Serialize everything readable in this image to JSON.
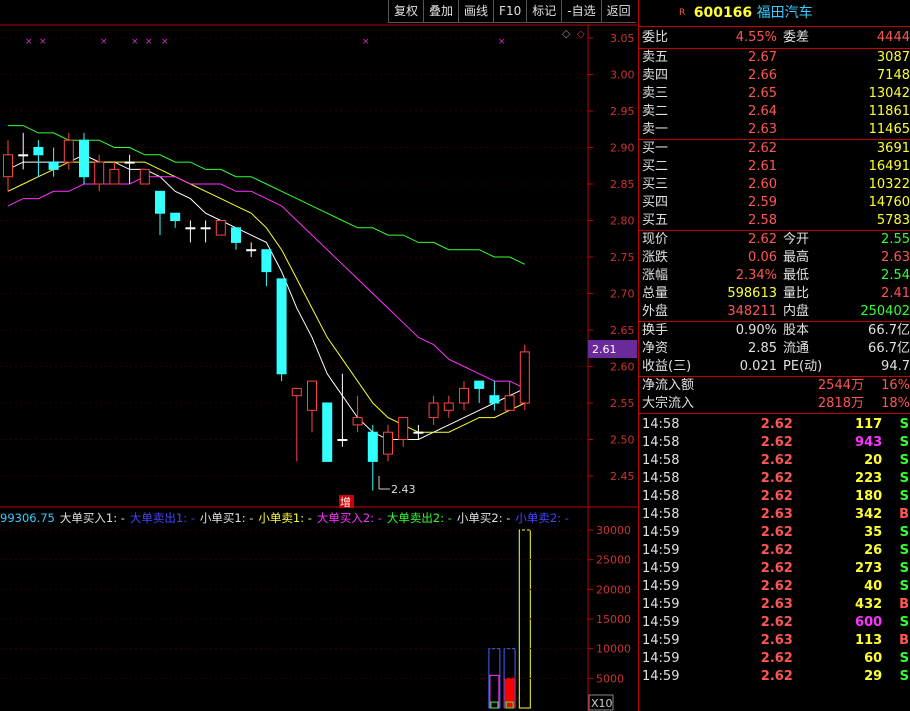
{
  "toolbar": {
    "items": [
      "复权",
      "叠加",
      "画线",
      "F10",
      "标记",
      "-自选",
      "返回"
    ]
  },
  "stock": {
    "flag": "R",
    "code": "600166",
    "name": "福田汽车"
  },
  "price_axis": {
    "ticks": [
      "3.05",
      "3.00",
      "2.95",
      "2.90",
      "2.85",
      "2.80",
      "2.75",
      "2.70",
      "2.65",
      "2.60",
      "2.55",
      "2.50",
      "2.45"
    ],
    "current": "2.61"
  },
  "chart_labels": {
    "low_marker": "2.43",
    "add_marker": "增"
  },
  "volume_axis": {
    "ticks": [
      "30000",
      "25000",
      "20000",
      "15000",
      "10000",
      "5000"
    ],
    "multiplier": "X10"
  },
  "legend": [
    {
      "text": "99306.75",
      "color": "#33ccff"
    },
    {
      "text": "大单买入1: -",
      "color": "#e0e0e0"
    },
    {
      "text": "大单卖出1: -",
      "color": "#4444ff"
    },
    {
      "text": "小单买1: -",
      "color": "#e0e0e0"
    },
    {
      "text": "小单卖1: -",
      "color": "#ffff33"
    },
    {
      "text": "大单买入2: -",
      "color": "#ff33ff"
    },
    {
      "text": "大单卖出2: -",
      "color": "#33ff33"
    },
    {
      "text": "小单买2: -",
      "color": "#e0e0e0"
    },
    {
      "text": "小单卖2: -",
      "color": "#4444ff"
    }
  ],
  "quote": {
    "wei": {
      "label": "委比",
      "value": "4.55%",
      "label2": "委差",
      "value2": "4444"
    },
    "sells": [
      {
        "label": "卖五",
        "price": "2.67",
        "vol": "3087"
      },
      {
        "label": "卖四",
        "price": "2.66",
        "vol": "7148"
      },
      {
        "label": "卖三",
        "price": "2.65",
        "vol": "13042"
      },
      {
        "label": "卖二",
        "price": "2.64",
        "vol": "11861"
      },
      {
        "label": "卖一",
        "price": "2.63",
        "vol": "11465"
      }
    ],
    "buys": [
      {
        "label": "买一",
        "price": "2.62",
        "vol": "3691"
      },
      {
        "label": "买二",
        "price": "2.61",
        "vol": "16491"
      },
      {
        "label": "买三",
        "price": "2.60",
        "vol": "10322"
      },
      {
        "label": "买四",
        "price": "2.59",
        "vol": "14760"
      },
      {
        "label": "买五",
        "price": "2.58",
        "vol": "5783"
      }
    ],
    "stats1": [
      {
        "l1": "现价",
        "v1": "2.62",
        "c1": "#ff5555",
        "l2": "今开",
        "v2": "2.55",
        "c2": "#33ff33"
      },
      {
        "l1": "涨跌",
        "v1": "0.06",
        "c1": "#ff5555",
        "l2": "最高",
        "v2": "2.63",
        "c2": "#ff5555"
      },
      {
        "l1": "涨幅",
        "v1": "2.34%",
        "c1": "#ff5555",
        "l2": "最低",
        "v2": "2.54",
        "c2": "#33ff33"
      },
      {
        "l1": "总量",
        "v1": "598613",
        "c1": "#ffff33",
        "l2": "量比",
        "v2": "2.41",
        "c2": "#ff5555"
      },
      {
        "l1": "外盘",
        "v1": "348211",
        "c1": "#ff5555",
        "l2": "内盘",
        "v2": "250402",
        "c2": "#33ff33"
      }
    ],
    "stats2": [
      {
        "l1": "换手",
        "v1": "0.90%",
        "l2": "股本",
        "v2": "66.7亿"
      },
      {
        "l1": "净资",
        "v1": "2.85",
        "l2": "流通",
        "v2": "66.7亿"
      },
      {
        "l1": "收益(三)",
        "v1": "0.021",
        "l2": "PE(动)",
        "v2": "94.7"
      }
    ],
    "flows": [
      {
        "label": "净流入额",
        "value": "2544万",
        "pct": "16%"
      },
      {
        "label": "大宗流入",
        "value": "2818万",
        "pct": "18%"
      }
    ]
  },
  "ticks": [
    {
      "time": "14:58",
      "price": "2.62",
      "vol": "117",
      "bs": "S",
      "vc": "#ffff33"
    },
    {
      "time": "14:58",
      "price": "2.62",
      "vol": "943",
      "bs": "S",
      "vc": "#ff33ff"
    },
    {
      "time": "14:58",
      "price": "2.62",
      "vol": "20",
      "bs": "S",
      "vc": "#ffff33"
    },
    {
      "time": "14:58",
      "price": "2.62",
      "vol": "223",
      "bs": "S",
      "vc": "#ffff33"
    },
    {
      "time": "14:58",
      "price": "2.62",
      "vol": "180",
      "bs": "S",
      "vc": "#ffff33"
    },
    {
      "time": "14:58",
      "price": "2.63",
      "vol": "342",
      "bs": "B",
      "vc": "#ffff33"
    },
    {
      "time": "14:59",
      "price": "2.62",
      "vol": "35",
      "bs": "S",
      "vc": "#ffff33"
    },
    {
      "time": "14:59",
      "price": "2.62",
      "vol": "26",
      "bs": "S",
      "vc": "#ffff33"
    },
    {
      "time": "14:59",
      "price": "2.62",
      "vol": "273",
      "bs": "S",
      "vc": "#ffff33"
    },
    {
      "time": "14:59",
      "price": "2.62",
      "vol": "40",
      "bs": "S",
      "vc": "#ffff33"
    },
    {
      "time": "14:59",
      "price": "2.63",
      "vol": "432",
      "bs": "B",
      "vc": "#ffff33"
    },
    {
      "time": "14:59",
      "price": "2.62",
      "vol": "600",
      "bs": "S",
      "vc": "#ff33ff"
    },
    {
      "time": "14:59",
      "price": "2.63",
      "vol": "113",
      "bs": "B",
      "vc": "#ffff33"
    },
    {
      "time": "14:59",
      "price": "2.62",
      "vol": "60",
      "bs": "S",
      "vc": "#ffff33"
    },
    {
      "time": "14:59",
      "price": "2.62",
      "vol": "29",
      "bs": "S",
      "vc": "#ffff33"
    }
  ],
  "chart_data": {
    "type": "candlestick",
    "ylim": [
      2.41,
      3.07
    ],
    "candles": [
      {
        "o": 2.86,
        "c": 2.89,
        "h": 2.91,
        "l": 2.84
      },
      {
        "o": 2.89,
        "c": 2.89,
        "h": 2.92,
        "l": 2.87
      },
      {
        "o": 2.9,
        "c": 2.89,
        "h": 2.91,
        "l": 2.86
      },
      {
        "o": 2.88,
        "c": 2.87,
        "h": 2.9,
        "l": 2.86
      },
      {
        "o": 2.88,
        "c": 2.91,
        "h": 2.92,
        "l": 2.87
      },
      {
        "o": 2.91,
        "c": 2.86,
        "h": 2.92,
        "l": 2.85
      },
      {
        "o": 2.85,
        "c": 2.88,
        "h": 2.89,
        "l": 2.84
      },
      {
        "o": 2.85,
        "c": 2.87,
        "h": 2.88,
        "l": 2.85
      },
      {
        "o": 2.88,
        "c": 2.88,
        "h": 2.89,
        "l": 2.85
      },
      {
        "o": 2.85,
        "c": 2.87,
        "h": 2.87,
        "l": 2.85
      },
      {
        "o": 2.84,
        "c": 2.81,
        "h": 2.84,
        "l": 2.78
      },
      {
        "o": 2.81,
        "c": 2.8,
        "h": 2.81,
        "l": 2.79
      },
      {
        "o": 2.79,
        "c": 2.79,
        "h": 2.8,
        "l": 2.77
      },
      {
        "o": 2.79,
        "c": 2.79,
        "h": 2.8,
        "l": 2.77
      },
      {
        "o": 2.78,
        "c": 2.8,
        "h": 2.8,
        "l": 2.78
      },
      {
        "o": 2.79,
        "c": 2.77,
        "h": 2.79,
        "l": 2.76
      },
      {
        "o": 2.76,
        "c": 2.76,
        "h": 2.77,
        "l": 2.75
      },
      {
        "o": 2.76,
        "c": 2.73,
        "h": 2.76,
        "l": 2.71
      },
      {
        "o": 2.72,
        "c": 2.59,
        "h": 2.72,
        "l": 2.58
      },
      {
        "o": 2.56,
        "c": 2.57,
        "h": 2.57,
        "l": 2.47
      },
      {
        "o": 2.54,
        "c": 2.58,
        "h": 2.58,
        "l": 2.51
      },
      {
        "o": 2.55,
        "c": 2.47,
        "h": 2.55,
        "l": 2.47
      },
      {
        "o": 2.5,
        "c": 2.5,
        "h": 2.59,
        "l": 2.49
      },
      {
        "o": 2.52,
        "c": 2.53,
        "h": 2.56,
        "l": 2.51
      },
      {
        "o": 2.51,
        "c": 2.47,
        "h": 2.52,
        "l": 2.43
      },
      {
        "o": 2.48,
        "c": 2.51,
        "h": 2.52,
        "l": 2.47
      },
      {
        "o": 2.5,
        "c": 2.53,
        "h": 2.53,
        "l": 2.49
      },
      {
        "o": 2.51,
        "c": 2.51,
        "h": 2.52,
        "l": 2.5
      },
      {
        "o": 2.53,
        "c": 2.55,
        "h": 2.56,
        "l": 2.52
      },
      {
        "o": 2.54,
        "c": 2.55,
        "h": 2.56,
        "l": 2.53
      },
      {
        "o": 2.55,
        "c": 2.57,
        "h": 2.58,
        "l": 2.54
      },
      {
        "o": 2.58,
        "c": 2.57,
        "h": 2.58,
        "l": 2.55
      },
      {
        "o": 2.56,
        "c": 2.55,
        "h": 2.58,
        "l": 2.54
      },
      {
        "o": 2.54,
        "c": 2.56,
        "h": 2.58,
        "l": 2.54
      },
      {
        "o": 2.55,
        "c": 2.62,
        "h": 2.63,
        "l": 2.54
      }
    ],
    "ma_series": [
      {
        "color": "#ffffff",
        "values": [
          2.87,
          2.88,
          2.88,
          2.88,
          2.88,
          2.89,
          2.88,
          2.88,
          2.87,
          2.87,
          2.86,
          2.84,
          2.83,
          2.81,
          2.8,
          2.79,
          2.78,
          2.77,
          2.73,
          2.68,
          2.64,
          2.59,
          2.56,
          2.53,
          2.51,
          2.5,
          2.5,
          2.5,
          2.51,
          2.52,
          2.53,
          2.54,
          2.55,
          2.56,
          2.57
        ]
      },
      {
        "color": "#ffff33",
        "values": [
          2.84,
          2.85,
          2.86,
          2.87,
          2.88,
          2.88,
          2.88,
          2.88,
          2.88,
          2.88,
          2.87,
          2.86,
          2.85,
          2.84,
          2.83,
          2.82,
          2.81,
          2.79,
          2.76,
          2.72,
          2.68,
          2.64,
          2.61,
          2.58,
          2.55,
          2.53,
          2.52,
          2.51,
          2.51,
          2.51,
          2.52,
          2.53,
          2.53,
          2.54,
          2.55
        ]
      },
      {
        "color": "#ff33ff",
        "values": [
          2.82,
          2.83,
          2.83,
          2.84,
          2.84,
          2.85,
          2.85,
          2.85,
          2.85,
          2.86,
          2.86,
          2.86,
          2.85,
          2.85,
          2.85,
          2.84,
          2.84,
          2.83,
          2.82,
          2.8,
          2.78,
          2.76,
          2.74,
          2.72,
          2.7,
          2.68,
          2.66,
          2.64,
          2.63,
          2.61,
          2.6,
          2.59,
          2.58,
          2.58,
          2.57
        ]
      },
      {
        "color": "#33ff33",
        "values": [
          2.93,
          2.93,
          2.92,
          2.92,
          2.91,
          2.91,
          2.91,
          2.9,
          2.9,
          2.89,
          2.89,
          2.88,
          2.88,
          2.87,
          2.87,
          2.86,
          2.86,
          2.85,
          2.84,
          2.83,
          2.82,
          2.81,
          2.8,
          2.79,
          2.79,
          2.78,
          2.78,
          2.77,
          2.77,
          2.76,
          2.76,
          2.76,
          2.75,
          2.75,
          2.74
        ]
      }
    ],
    "volume_bars": [
      {
        "index": 32,
        "values": [
          10000,
          5500,
          1000
        ],
        "colors": [
          "#4466ff",
          "#ff33ff",
          "#33ff33"
        ]
      },
      {
        "index": 33,
        "values": [
          10000,
          5000,
          1000
        ],
        "colors": [
          "#4466ff",
          "#ff0000",
          "#33ff33"
        ]
      },
      {
        "index": 34,
        "values": [
          30000
        ],
        "colors": [
          "#ffff33"
        ]
      }
    ]
  }
}
